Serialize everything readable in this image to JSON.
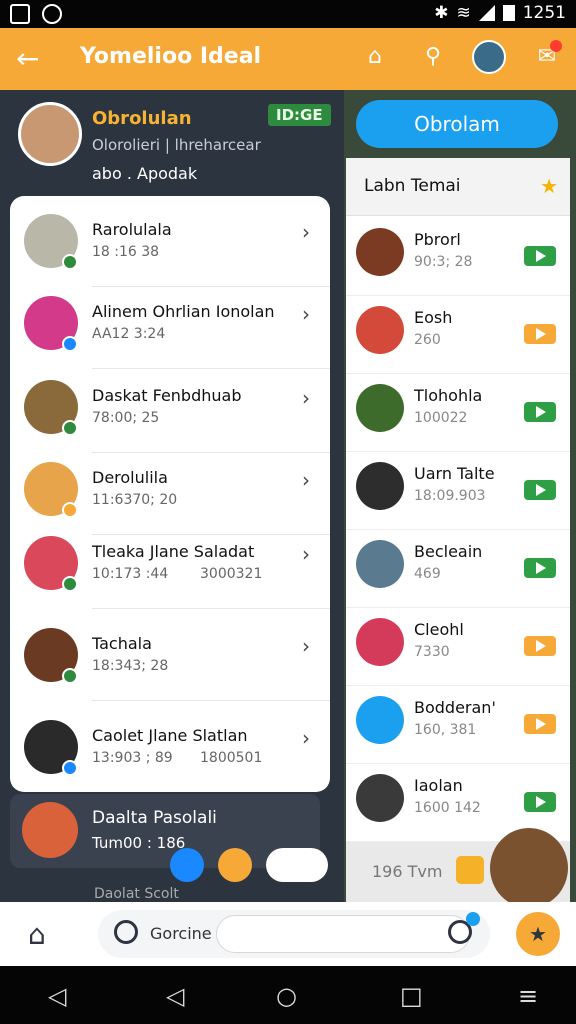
{
  "status_bar": {
    "time": "1251"
  },
  "app_bar": {
    "title": "Yomelioo Ideal"
  },
  "profile": {
    "name": "Obrolulan",
    "subtitle": "Olorolieri | lhreharcear",
    "stat": "abo . Apodak",
    "badge": "ID:GE"
  },
  "left_list": [
    {
      "name": "Rarolulala",
      "meta": "18 :16 38",
      "status_color": "#2e8a3d",
      "avatar_color": "#b9b7a8"
    },
    {
      "name": "Alinem Ohrlian Ionolan",
      "meta": "AA12 3:24",
      "status_color": "#1a88ff",
      "avatar_color": "#d33a8a"
    },
    {
      "name": "Daskat Fenbdhuab",
      "meta": "78:00; 25",
      "status_color": "#2e8a3d",
      "avatar_color": "#8a6a3b"
    },
    {
      "name": "Derolulila",
      "meta": "11:6370; 20",
      "status_color": "#f7a937",
      "avatar_color": "#e7a44a"
    },
    {
      "name": "Tleaka Jlane Saladat",
      "meta": "10:173 :44",
      "extra": "3000321",
      "status_color": "#2e8a3d",
      "avatar_color": "#d9495b"
    },
    {
      "name": "Tachala",
      "meta": "18:343; 28",
      "status_color": "#2e8a3d",
      "avatar_color": "#6b3a22"
    },
    {
      "name": "Caolet Jlane Slatlan",
      "meta": "13:903 ; 89",
      "extra": "1800501",
      "status_color": "#1a88ff",
      "avatar_color": "#2a2a2a"
    }
  ],
  "highlight_row": {
    "name": "Daalta Pasolali",
    "meta": "Tum00 : 186"
  },
  "partial_row": {
    "name": "Daolat Scolt"
  },
  "cta_button": "Obrolam",
  "right_panel": {
    "header": "Labn Temai",
    "items": [
      {
        "name": "Pbrorl",
        "meta": "90:3; 28",
        "button_color": "#2e9f44",
        "avatar_color": "#7b3a22"
      },
      {
        "name": "Eosh",
        "meta": "260",
        "button_color": "#f7a937",
        "avatar_color": "#d44a3a"
      },
      {
        "name": "Tlohohla",
        "meta": "100022",
        "button_color": "#2e9f44",
        "avatar_color": "#3d6b2c"
      },
      {
        "name": "Uarn Talte",
        "meta": "18:09.903",
        "button_color": "#2e9f44",
        "avatar_color": "#2d2d2d"
      },
      {
        "name": "Becleain",
        "meta": "469",
        "button_color": "#2e9f44",
        "avatar_color": "#5a7a90"
      },
      {
        "name": "Cleohl",
        "meta": "7330",
        "button_color": "#f7a937",
        "avatar_color": "#d43a5a"
      },
      {
        "name": "Bodderan'",
        "meta": "160, 381",
        "button_color": "#f7a937",
        "avatar_color": "#1aa0ef"
      },
      {
        "name": "Iaolan",
        "meta": "1600 142",
        "button_color": "#2e9f44",
        "avatar_color": "#3a3a3a"
      }
    ],
    "footer_text": "196 Tvm"
  },
  "bottom_nav": {
    "search_label": "Gorcine"
  }
}
